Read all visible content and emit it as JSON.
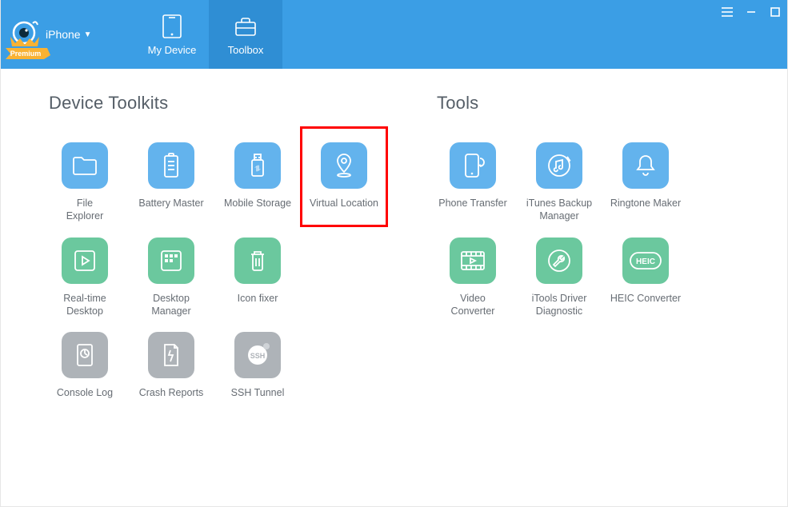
{
  "header": {
    "device_label": "iPhone",
    "premium_label": "Premium",
    "tabs": {
      "my_device": "My Device",
      "toolbox": "Toolbox"
    }
  },
  "sections": {
    "device_toolkits_title": "Device Toolkits",
    "tools_title": "Tools"
  },
  "device_toolkits": {
    "file_explorer": "File\nExplorer",
    "battery_master": "Battery Master",
    "mobile_storage": "Mobile Storage",
    "virtual_location": "Virtual Location",
    "realtime_desktop": "Real-time\nDesktop",
    "desktop_manager": "Desktop\nManager",
    "icon_fixer": "Icon fixer",
    "console_log": "Console Log",
    "crash_reports": "Crash Reports",
    "ssh_tunnel": "SSH Tunnel"
  },
  "tools": {
    "phone_transfer": "Phone Transfer",
    "itunes_backup": "iTunes Backup\nManager",
    "ringtone_maker": "Ringtone Maker",
    "video_converter": "Video\nConverter",
    "itools_driver": "iTools Driver\nDiagnostic",
    "heic_converter": "HEIC Converter",
    "heic_badge": "HEIC"
  }
}
